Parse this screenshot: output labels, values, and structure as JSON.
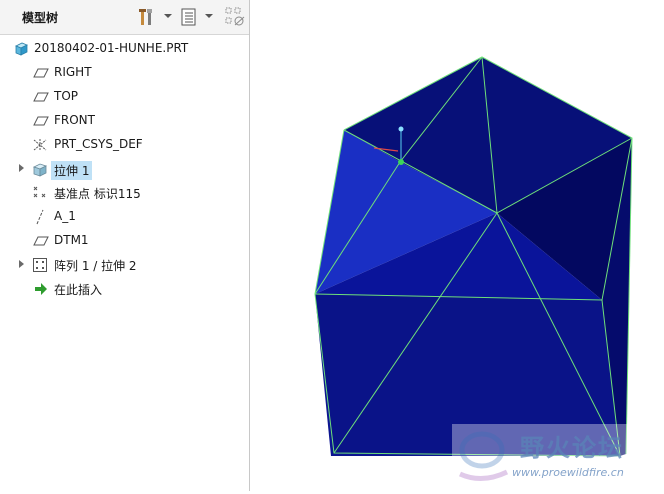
{
  "model_tree": {
    "title": "模型树",
    "header_icons": [
      "settings-tools-icon",
      "tree-columns-icon",
      "filter-display-icon"
    ],
    "items": [
      {
        "label": "20180402-01-HUNHE.PRT",
        "icon": "part-icon",
        "expandable": false,
        "selected": false
      },
      {
        "label": "RIGHT",
        "icon": "datum-plane-icon",
        "expandable": false,
        "selected": false
      },
      {
        "label": "TOP",
        "icon": "datum-plane-icon",
        "expandable": false,
        "selected": false
      },
      {
        "label": "FRONT",
        "icon": "datum-plane-icon",
        "expandable": false,
        "selected": false
      },
      {
        "label": "PRT_CSYS_DEF",
        "icon": "coordinate-system-icon",
        "expandable": false,
        "selected": false
      },
      {
        "label": "拉伸 1",
        "icon": "extrude-icon",
        "expandable": true,
        "selected": true
      },
      {
        "label": "基准点 标识115",
        "icon": "datum-point-icon",
        "expandable": false,
        "selected": false
      },
      {
        "label": "A_1",
        "icon": "datum-axis-icon",
        "expandable": false,
        "selected": false
      },
      {
        "label": "DTM1",
        "icon": "datum-plane-icon",
        "expandable": false,
        "selected": false
      },
      {
        "label": "阵列 1 / 拉伸 2",
        "icon": "pattern-icon",
        "expandable": true,
        "selected": false
      },
      {
        "label": "在此插入",
        "icon": "insert-here-arrow-icon",
        "expandable": false,
        "selected": false
      }
    ]
  },
  "viewport": {
    "solid_color": "#0a0f8c",
    "edge_color": "#6ee07a",
    "selection_color": "#e04848"
  },
  "watermark": {
    "text": "野火论坛",
    "url": "www.proewildfire.cn"
  }
}
